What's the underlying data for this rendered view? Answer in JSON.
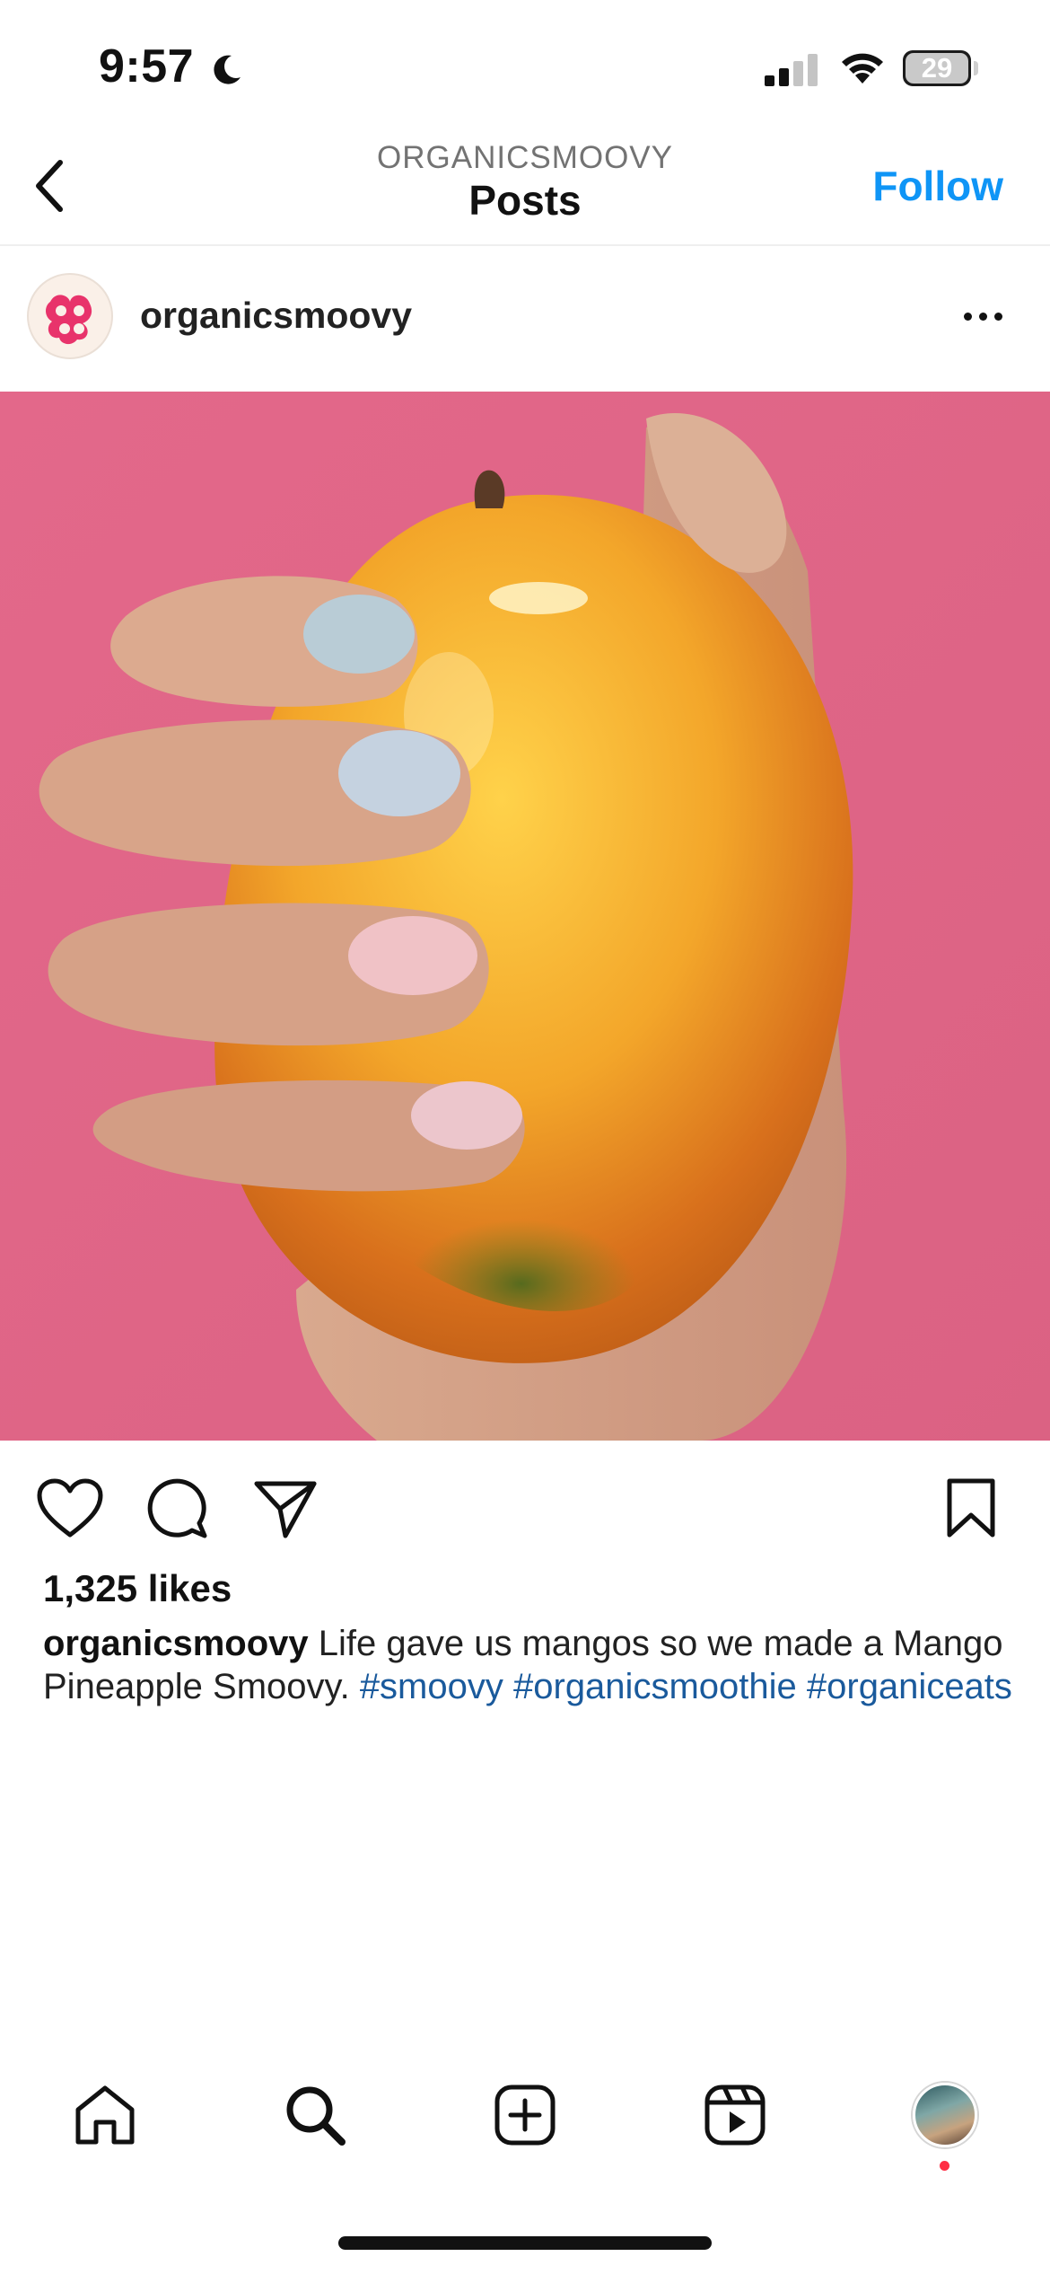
{
  "status_bar": {
    "time": "9:57",
    "battery": "29",
    "icons": [
      "moon-icon",
      "signal-icon",
      "wifi-icon",
      "battery-icon"
    ]
  },
  "header": {
    "subtitle": "ORGANICSMOOVY",
    "title": "Posts",
    "follow_label": "Follow",
    "accent_color": "#0f95f6"
  },
  "post": {
    "username": "organicsmoovy",
    "image_description": "hand-holding-mango",
    "likes": "1,325 likes",
    "caption": {
      "username": "organicsmoovy",
      "text": "Life gave us mangos so we made a Mango Pineapple Smoovy.",
      "hashtags": [
        "#smoovy",
        "#organicsmoothie",
        "#organiceats"
      ],
      "hashtag_color": "#1a5a9c"
    }
  },
  "actions": [
    "heart-icon",
    "comment-icon",
    "share-icon",
    "bookmark-icon"
  ],
  "tab_bar": {
    "tabs": [
      "home-icon",
      "search-icon",
      "create-icon",
      "reels-icon",
      "profile-avatar"
    ],
    "notification_color": "#ff2d43"
  }
}
